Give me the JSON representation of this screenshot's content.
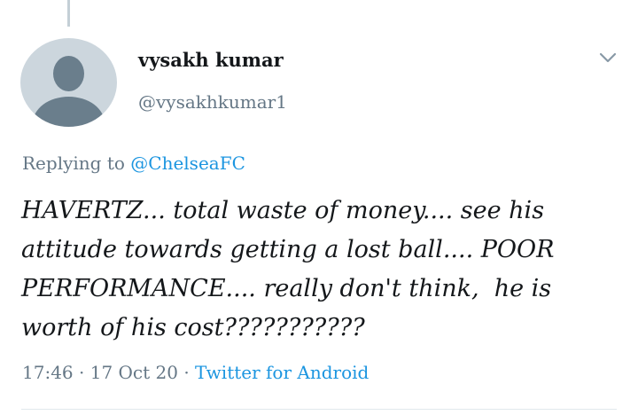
{
  "author": {
    "name": "vysakh kumar",
    "handle": "@vysakhkumar1"
  },
  "icons": {
    "avatar": "default-avatar-icon",
    "menu": "chevron-down-icon"
  },
  "reply": {
    "prefix": "Replying to ",
    "mention": "@ChelseaFC"
  },
  "tweet": {
    "lines": [
      "HAVERTZ... total waste of money.... see his",
      "attitude towards getting a lost ball.... POOR",
      "PERFORMANCE.... really don't think,  he is",
      "worth of his cost???????????"
    ]
  },
  "meta": {
    "time": "17:46",
    "sep1": " · ",
    "date": "17 Oct 20",
    "sep2": " · ",
    "source": "Twitter for Android"
  },
  "colors": {
    "text_primary": "#14171a",
    "text_secondary": "#657786",
    "link": "#1b95e0",
    "avatar_bg": "#ccd6dd",
    "avatar_fg": "#6a7e8c"
  }
}
